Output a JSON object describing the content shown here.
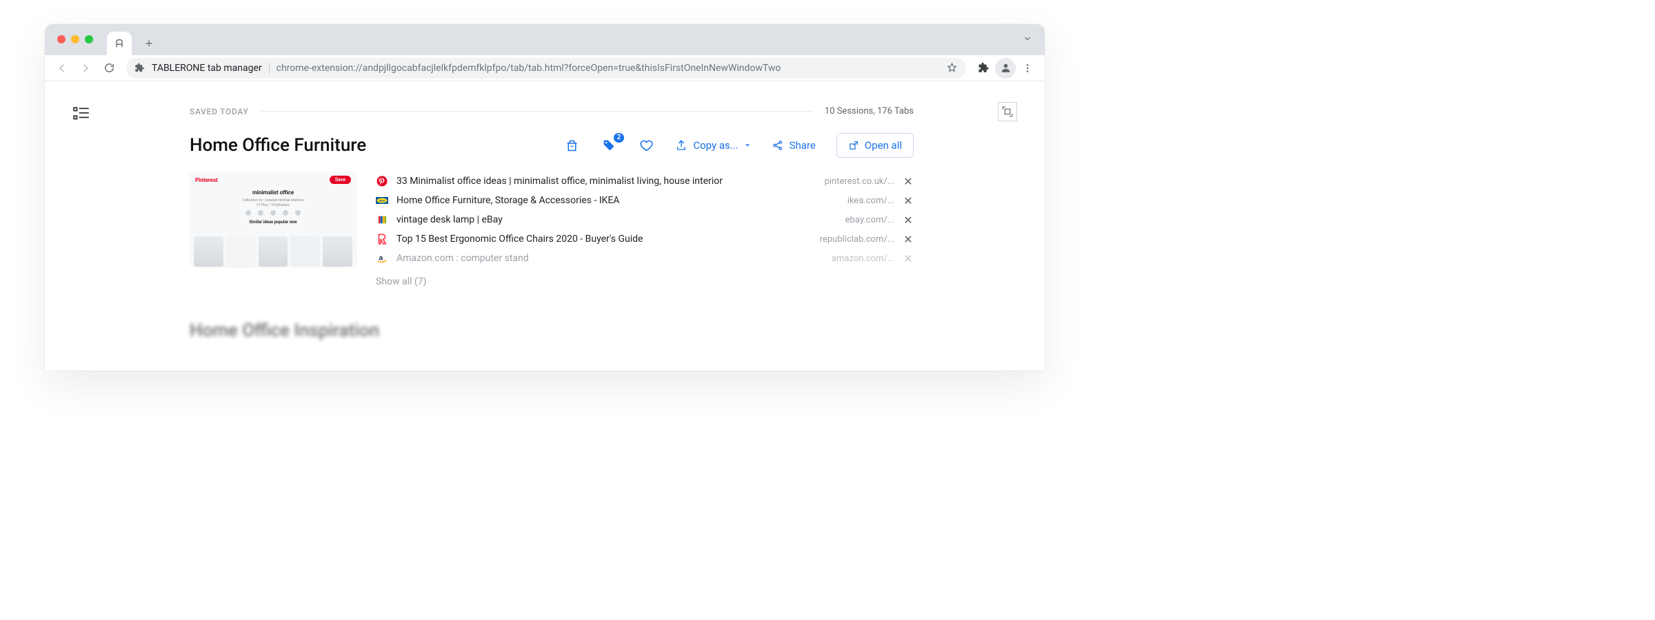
{
  "browser": {
    "page_title": "TABLERONE tab manager",
    "url": "chrome-extension://andpjllgocabfacjlelkfpdemfklpfpo/tab/tab.html?forceOpen=true&thisIsFirstOneInNewWindowTwo"
  },
  "header": {
    "saved_label": "Saved Today",
    "counts": "10 Sessions, 176 Tabs"
  },
  "session": {
    "title": "Home Office Furniture",
    "tag_badge": "2",
    "actions": {
      "copy_as": "Copy as...",
      "share": "Share",
      "open_all": "Open all"
    },
    "thumb": {
      "logo": "Pinterest",
      "save": "Save",
      "title": "minimalist office",
      "section": "Similar ideas popular now"
    },
    "tabs": [
      {
        "title": "33 Minimalist office ideas | minimalist office, minimalist living, house interior",
        "domain": "pinterest.co.uk/...",
        "favicon": "pinterest"
      },
      {
        "title": "Home Office Furniture, Storage & Accessories - IKEA",
        "domain": "ikea.com/...",
        "favicon": "ikea"
      },
      {
        "title": "vintage desk lamp | eBay",
        "domain": "ebay.com/...",
        "favicon": "ebay"
      },
      {
        "title": "Top 15 Best Ergonomic Office Chairs 2020 - Buyer's Guide",
        "domain": "republiclab.com/...",
        "favicon": "republiclab"
      },
      {
        "title": "Amazon.com : computer stand",
        "domain": "amazon.com/...",
        "favicon": "amazon",
        "faded": true
      }
    ],
    "show_all": "Show all (7)"
  },
  "next_session": {
    "title": "Home Office Inspiration"
  }
}
